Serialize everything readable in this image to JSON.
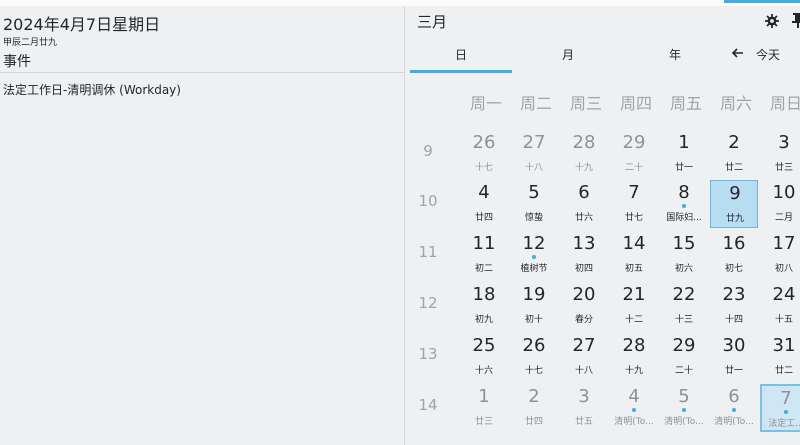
{
  "left": {
    "date_title": "2024年4月7日星期日",
    "lunar_subtitle": "甲辰二月廿九",
    "events_title": "事件",
    "events": [
      {
        "label": "法定工作日-清明调休 (Workday)"
      }
    ]
  },
  "right": {
    "month_title": "三月",
    "tabs": [
      "日",
      "月",
      "年"
    ],
    "active_tab": "日",
    "today_label": "今天",
    "weekdays": [
      "周一",
      "周二",
      "周三",
      "周四",
      "周五",
      "周六",
      "周日"
    ],
    "weeks": [
      {
        "week": "9",
        "days": [
          {
            "n": "26",
            "l": "十七",
            "other": true
          },
          {
            "n": "27",
            "l": "十八",
            "other": true
          },
          {
            "n": "28",
            "l": "十九",
            "other": true
          },
          {
            "n": "29",
            "l": "二十",
            "other": true
          },
          {
            "n": "1",
            "l": "廿一"
          },
          {
            "n": "2",
            "l": "廿二"
          },
          {
            "n": "3",
            "l": "廿三"
          }
        ]
      },
      {
        "week": "10",
        "days": [
          {
            "n": "4",
            "l": "廿四"
          },
          {
            "n": "5",
            "l": "惊蛰"
          },
          {
            "n": "6",
            "l": "廿六"
          },
          {
            "n": "7",
            "l": "廿七"
          },
          {
            "n": "8",
            "l": "国际妇...",
            "dot": true
          },
          {
            "n": "9",
            "l": "廿九",
            "selected": true
          },
          {
            "n": "10",
            "l": "二月"
          }
        ]
      },
      {
        "week": "11",
        "days": [
          {
            "n": "11",
            "l": "初二"
          },
          {
            "n": "12",
            "l": "植树节",
            "dot": true
          },
          {
            "n": "13",
            "l": "初四"
          },
          {
            "n": "14",
            "l": "初五"
          },
          {
            "n": "15",
            "l": "初六"
          },
          {
            "n": "16",
            "l": "初七"
          },
          {
            "n": "17",
            "l": "初八"
          }
        ]
      },
      {
        "week": "12",
        "days": [
          {
            "n": "18",
            "l": "初九"
          },
          {
            "n": "19",
            "l": "初十"
          },
          {
            "n": "20",
            "l": "春分"
          },
          {
            "n": "21",
            "l": "十二"
          },
          {
            "n": "22",
            "l": "十三"
          },
          {
            "n": "23",
            "l": "十四"
          },
          {
            "n": "24",
            "l": "十五"
          }
        ]
      },
      {
        "week": "13",
        "days": [
          {
            "n": "25",
            "l": "十六"
          },
          {
            "n": "26",
            "l": "十七"
          },
          {
            "n": "27",
            "l": "十八"
          },
          {
            "n": "28",
            "l": "十九"
          },
          {
            "n": "29",
            "l": "二十"
          },
          {
            "n": "30",
            "l": "廿一"
          },
          {
            "n": "31",
            "l": "廿二"
          }
        ]
      },
      {
        "week": "14",
        "days": [
          {
            "n": "1",
            "l": "廿三",
            "other": true
          },
          {
            "n": "2",
            "l": "廿四",
            "other": true
          },
          {
            "n": "3",
            "l": "廿五",
            "other": true
          },
          {
            "n": "4",
            "l": "清明(To...",
            "other": true,
            "dot": true
          },
          {
            "n": "5",
            "l": "清明(To...",
            "other": true,
            "dot": true
          },
          {
            "n": "6",
            "l": "清明(To...",
            "other": true,
            "dot": true
          },
          {
            "n": "7",
            "l": "法定工...",
            "other": true,
            "dot": true,
            "today": true
          }
        ]
      }
    ]
  },
  "colors": {
    "accent": "#3daee9",
    "background": "#eff0f1",
    "text": "#232629",
    "muted": "#a0a4a8"
  },
  "icons": [
    "gear-icon",
    "pin-icon",
    "arrow-left-icon"
  ]
}
